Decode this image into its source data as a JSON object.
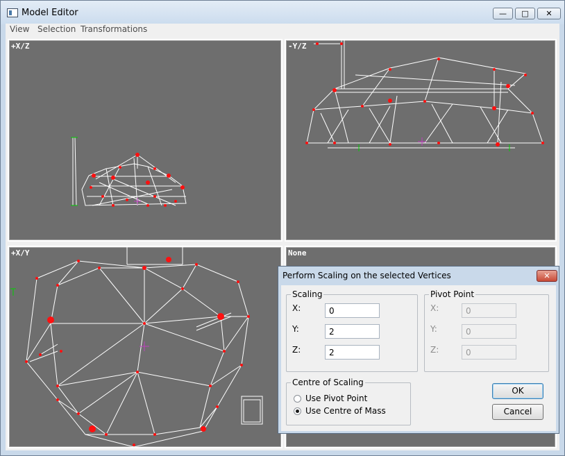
{
  "window": {
    "title": "Model Editor",
    "icon": "app-window-icon",
    "controls": {
      "minimize": "—",
      "maximize": "□",
      "close": "✕"
    }
  },
  "menu": {
    "items": [
      "View",
      "Selection",
      "Transformations"
    ]
  },
  "viewports": {
    "top_left": {
      "label": "+X/Z"
    },
    "top_right": {
      "label": "-Y/Z"
    },
    "bottom_left": {
      "label": "+X/Y"
    },
    "bottom_right": {
      "label": "None"
    }
  },
  "colors": {
    "viewport_bg": "#6e6e6e",
    "wire": "#ffffff",
    "vertex": "#ff1010",
    "axis_green": "#00d000",
    "pivot_magenta": "#c040c0"
  },
  "dialog": {
    "title": "Perform Scaling on the selected Vertices",
    "close_glyph": "✕",
    "scaling": {
      "legend": "Scaling",
      "x_label": "X:",
      "x_value": "0",
      "y_label": "Y:",
      "y_value": "2",
      "z_label": "Z:",
      "z_value": "2"
    },
    "pivot": {
      "legend": "Pivot Point",
      "x_label": "X:",
      "x_value": "0",
      "y_label": "Y:",
      "y_value": "0",
      "z_label": "Z:",
      "z_value": "0"
    },
    "centre": {
      "legend": "Centre of Scaling",
      "option_pivot": "Use Pivot Point",
      "option_mass": "Use Centre of Mass",
      "selected": "mass"
    },
    "ok_label": "OK",
    "cancel_label": "Cancel"
  }
}
